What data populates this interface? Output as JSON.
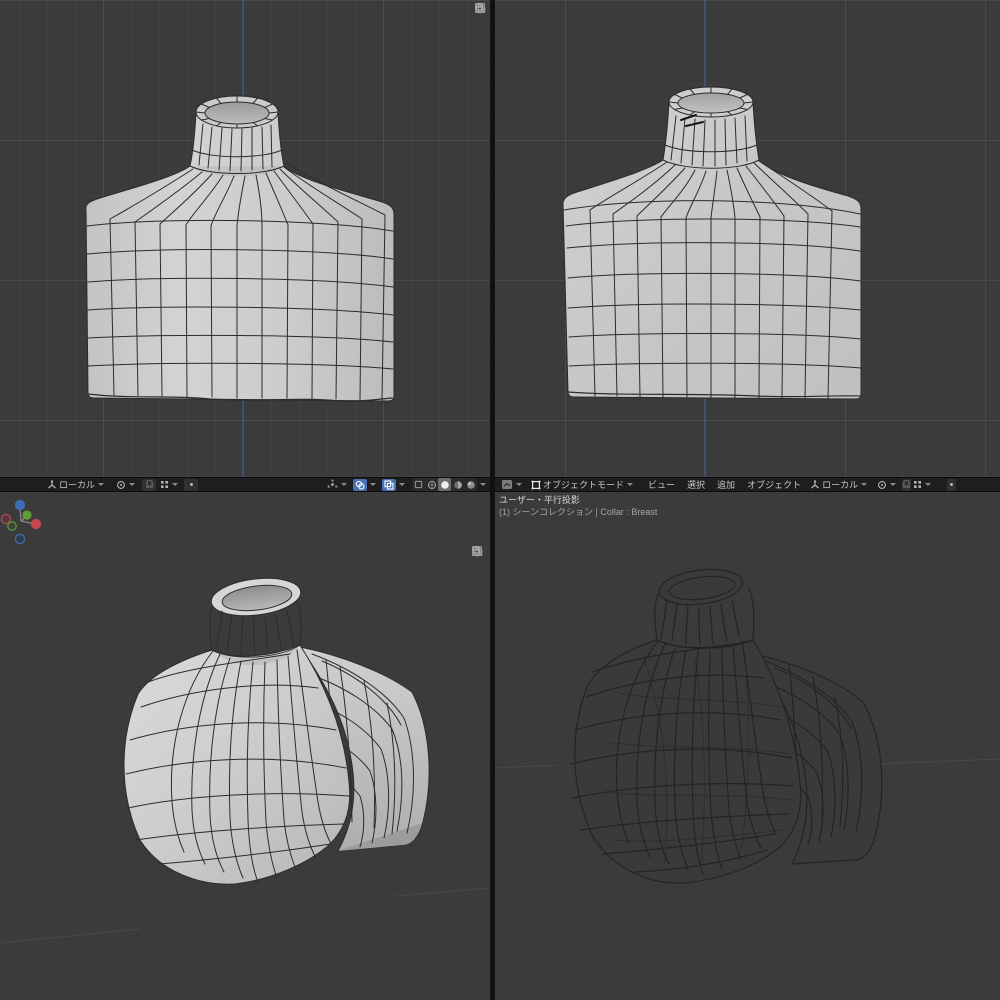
{
  "app_context": "blender-3d-viewport-quad-layout",
  "colors": {
    "viewport_bg": "#3b3b3b",
    "header_bg": "#1e1e1e",
    "gap": "#101010",
    "axis_z": "#3f5c8a",
    "accent": "#4772b3",
    "text": "#c8c8c8"
  },
  "header_left": {
    "orientation_label": "ローカル"
  },
  "header_right": {
    "mode_label": "オブジェクトモード",
    "menus": [
      {
        "label": "ビュー"
      },
      {
        "label": "選択"
      },
      {
        "label": "追加"
      },
      {
        "label": "オブジェクト"
      }
    ],
    "orientation_label": "ローカル"
  },
  "viewport_overlay": {
    "view_name": "ユーザー・平行投影",
    "breadcrumb": "(1) シーンコレクション | Collar : Breast"
  },
  "icons": {
    "transform_orientation": "axes-icon",
    "pivot_point": "pivot-icon",
    "snapping": "magnet-icon",
    "proportional_editing": "dot-circle-icon",
    "snap_mode": "four-dots-icon",
    "show_gizmo": "gizmo-icon",
    "show_overlays": "overlays-icon",
    "toggle_xray": "xray-icon",
    "shading_wireframe": "wireframe-sphere-icon",
    "shading_solid": "solid-sphere-icon",
    "shading_material": "material-sphere-icon",
    "shading_rendered": "rendered-sphere-icon",
    "nav_zoom": "magnifier-icon",
    "nav_pan": "hand-icon",
    "nav_camera": "camera-icon",
    "nav_ortho": "grid-icon"
  }
}
